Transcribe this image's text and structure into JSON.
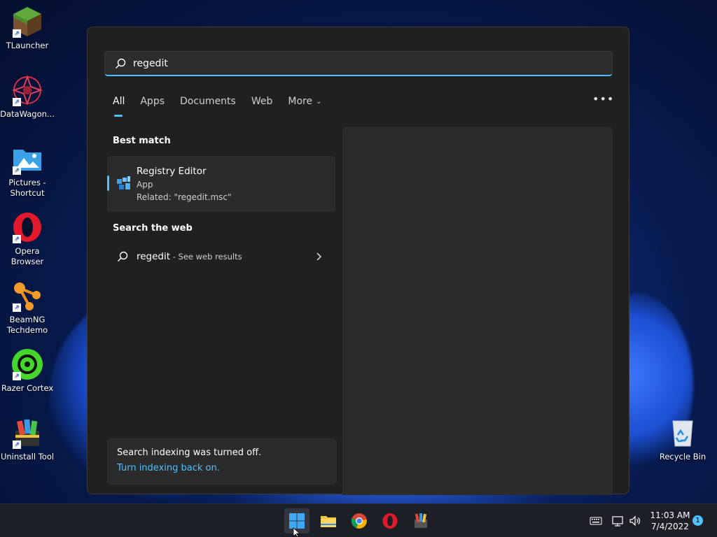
{
  "desktop": {
    "icons": [
      {
        "label": "TLauncher"
      },
      {
        "label": "DataWagon..."
      },
      {
        "label": "Pictures - Shortcut"
      },
      {
        "label": "Opera Browser"
      },
      {
        "label": "BeamNG Techdemo"
      },
      {
        "label": "Razer Cortex"
      },
      {
        "label": "Uninstall Tool"
      },
      {
        "label": "Recycle Bin"
      }
    ]
  },
  "search": {
    "query": "regedit",
    "tabs": [
      {
        "label": "All"
      },
      {
        "label": "Apps"
      },
      {
        "label": "Documents"
      },
      {
        "label": "Web"
      },
      {
        "label": "More"
      }
    ],
    "best_match_heading": "Best match",
    "best_match": {
      "title": "Registry Editor",
      "type": "App",
      "related": "Related: \"regedit.msc\""
    },
    "web_heading": "Search the web",
    "web_result": {
      "query": "regedit",
      "suffix": " - See web results"
    },
    "notice": {
      "text": "Search indexing was turned off.",
      "link": "Turn indexing back on."
    }
  },
  "taskbar": {
    "time": "11:03 AM",
    "date": "7/4/2022",
    "notification_count": "1"
  },
  "colors": {
    "accent": "#4cc2ff",
    "panel_bg": "#202020",
    "card_bg": "#2b2b2b"
  }
}
